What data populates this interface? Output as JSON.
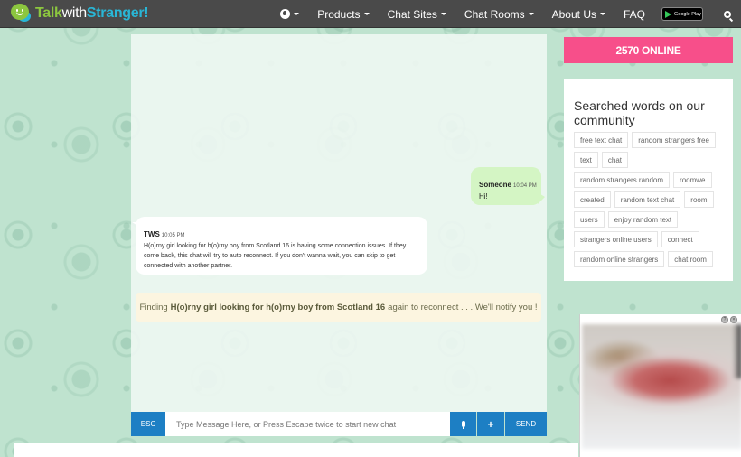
{
  "navbar": {
    "logo": {
      "part1": "Talk",
      "part2": "with",
      "part3": "Stranger!"
    },
    "items": [
      {
        "label": "Products",
        "dropdown": true
      },
      {
        "label": "Chat Sites",
        "dropdown": true
      },
      {
        "label": "Chat Rooms",
        "dropdown": true
      },
      {
        "label": "About Us",
        "dropdown": true
      },
      {
        "label": "FAQ",
        "dropdown": false
      }
    ],
    "google_play_label": "Google Play",
    "icons": {
      "language": "globe-icon",
      "search": "search-icon"
    }
  },
  "chat": {
    "messages": [
      {
        "sender": "Someone",
        "time": "10:04 PM",
        "text": "Hi!",
        "side": "right"
      },
      {
        "sender": "TWS",
        "time": "10:05 PM",
        "text": "H(o)rny girl looking for h(o)rny boy from Scotland 16 is having some connection issues. If they come back, this chat will try to auto reconnect. If you don't wanna wait, you can skip to get connected with another partner.",
        "side": "left"
      }
    ],
    "notice": {
      "prefix": "Finding",
      "name": "H(o)rny girl looking for h(o)rny boy from Scotland 16",
      "suffix": "again to reconnect . . . We'll notify you !"
    },
    "input": {
      "esc_label": "ESC",
      "placeholder": "Type Message Here, or Press Escape twice to start new chat",
      "value": "",
      "plus_label": "+",
      "send_label": "SEND"
    }
  },
  "sidebar": {
    "online_badge": "2570 ONLINE",
    "words_title": "Searched words on our community",
    "tags": [
      "free text chat",
      "random strangers free",
      "text",
      "chat",
      "random strangers random",
      "roomwe",
      "created",
      "random text chat",
      "room",
      "users",
      "enjoy random text",
      "strangers online users",
      "connect",
      "random online strangers",
      "chat room"
    ]
  },
  "video_popup": {
    "controls": [
      "?",
      "×"
    ]
  },
  "colors": {
    "navbar": "#4a4a4a",
    "logo_green": "#8cc63f",
    "logo_blue": "#29b6d6",
    "online_badge": "#f74f8a",
    "button_blue": "#1d7fc4",
    "my_bubble": "#d4f5c4",
    "notice_bg": "#fcf5e0"
  }
}
